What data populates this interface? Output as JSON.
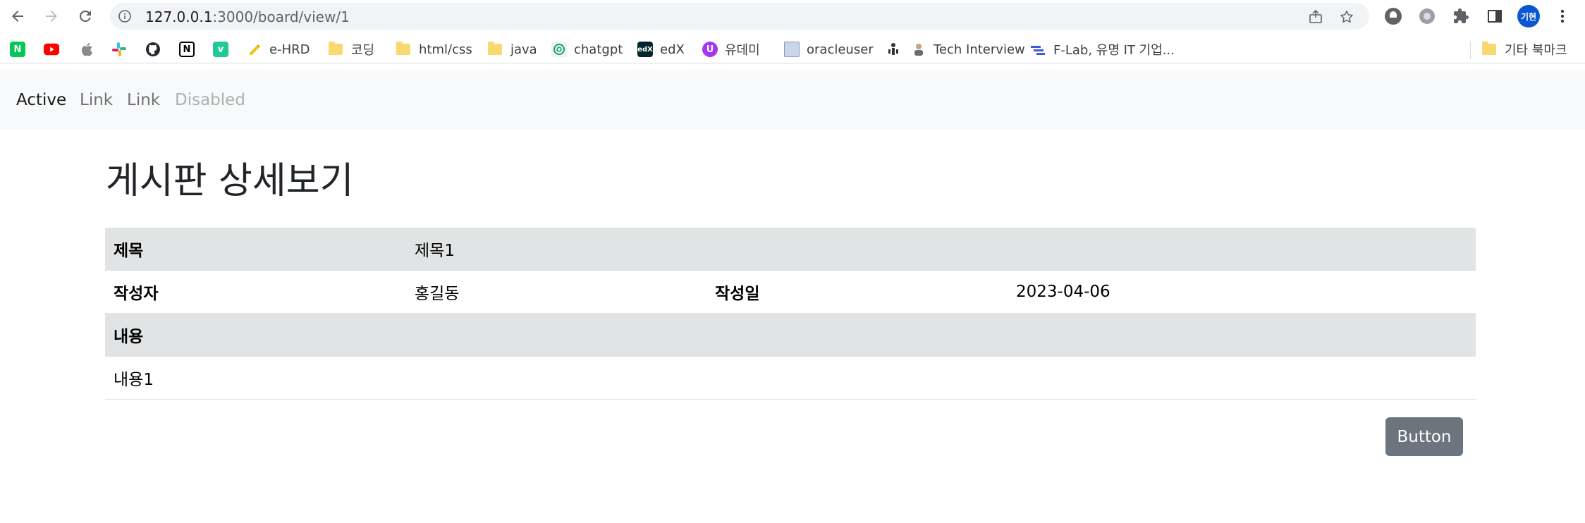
{
  "browser": {
    "url_host": "127.0.0.1",
    "url_rest": ":3000/board/view/1",
    "profile_label": "기현",
    "bookmarks": [
      {
        "label": "",
        "icon": "naver-icon"
      },
      {
        "label": "",
        "icon": "youtube-icon"
      },
      {
        "label": "",
        "icon": "apple-icon"
      },
      {
        "label": "",
        "icon": "slack-icon"
      },
      {
        "label": "",
        "icon": "github-icon"
      },
      {
        "label": "",
        "icon": "notion-icon"
      },
      {
        "label": "",
        "icon": "velog-icon"
      },
      {
        "label": "e-HRD",
        "icon": "pencil-icon"
      },
      {
        "label": "코딩",
        "icon": "folder-icon"
      },
      {
        "label": "html/css",
        "icon": "folder-icon"
      },
      {
        "label": "java",
        "icon": "folder-icon"
      },
      {
        "label": "chatgpt",
        "icon": "chatgpt-icon"
      },
      {
        "label": "edX",
        "icon": "edx-icon"
      },
      {
        "label": "유데미",
        "icon": "udemy-icon"
      },
      {
        "label": "oracleuser",
        "icon": "page-icon"
      },
      {
        "label": "",
        "icon": "podcast-icon"
      },
      {
        "label": "Tech Interview",
        "icon": "person-icon"
      },
      {
        "label": "F-Lab, 유명 IT 기업...",
        "icon": "flab-icon"
      },
      {
        "label": "기타 북마크",
        "icon": "folder-icon"
      }
    ]
  },
  "navbar": {
    "links": [
      {
        "label": "Active",
        "state": "active"
      },
      {
        "label": "Link",
        "state": "normal"
      },
      {
        "label": "Link",
        "state": "normal"
      },
      {
        "label": "Disabled",
        "state": "disabled"
      }
    ]
  },
  "page": {
    "title": "게시판 상세보기",
    "table": {
      "title_label": "제목",
      "title_value": "제목1",
      "author_label": "작성자",
      "author_value": "홍길동",
      "date_label": "작성일",
      "date_value": "2023-04-06",
      "content_label": "내용",
      "content_value": "내용1"
    },
    "button_label": "Button"
  },
  "colors": {
    "navbar_bg": "#f8f9fa",
    "row_gray": "#e2e3e5",
    "button_bg": "#6c757d"
  }
}
